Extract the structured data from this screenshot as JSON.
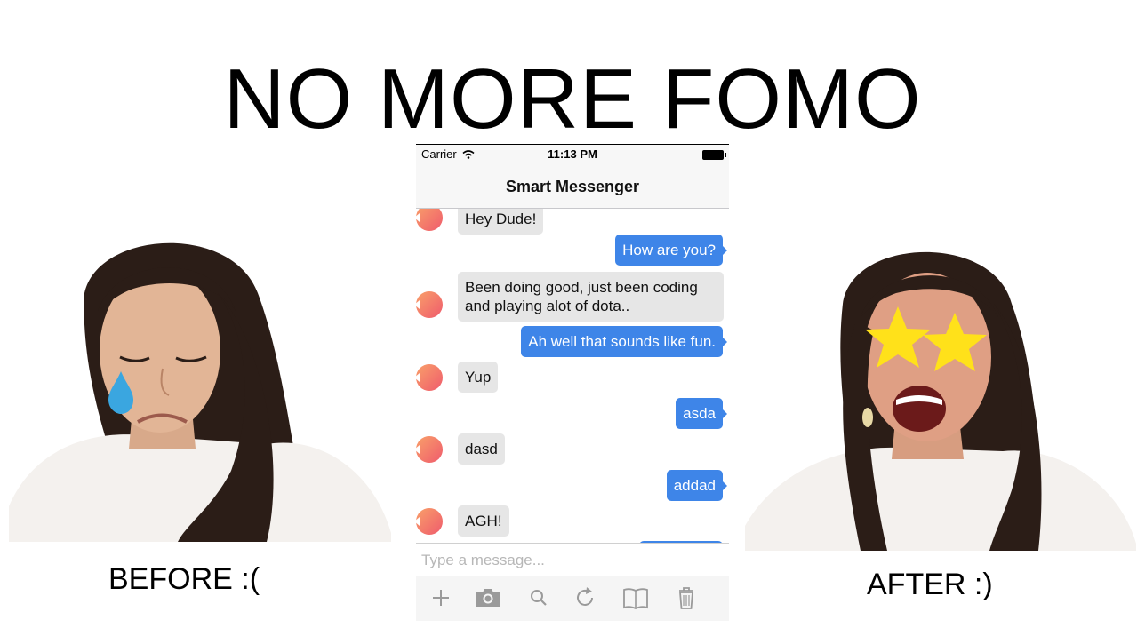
{
  "slide": {
    "headline": "NO MORE FOMO",
    "before_caption": "BEFORE :(",
    "after_caption": "AFTER :)"
  },
  "phone": {
    "status": {
      "carrier": "Carrier",
      "time": "11:13 PM"
    },
    "nav_title": "Smart Messenger",
    "messages": [
      {
        "from": "them",
        "text": "Hey Dude!"
      },
      {
        "from": "me",
        "text": "How are you?"
      },
      {
        "from": "them",
        "text": "Been doing good, just been coding\nand playing alot of dota.."
      },
      {
        "from": "me",
        "text": "Ah well that sounds like fun."
      },
      {
        "from": "them",
        "text": "Yup"
      },
      {
        "from": "me",
        "text": "asda"
      },
      {
        "from": "them",
        "text": "dasd"
      },
      {
        "from": "me",
        "text": "addad"
      },
      {
        "from": "them",
        "text": "AGH!"
      }
    ],
    "composer_placeholder": "Type a message...",
    "toolbar_icons": [
      "plus-icon",
      "camera-icon",
      "search-icon",
      "refresh-icon",
      "book-icon",
      "trash-icon"
    ]
  },
  "colors": {
    "outgoing_bubble": "#3e85e8",
    "incoming_bubble": "#e6e6e6",
    "star": "#ffe11a",
    "tear": "#3aa6e0"
  }
}
